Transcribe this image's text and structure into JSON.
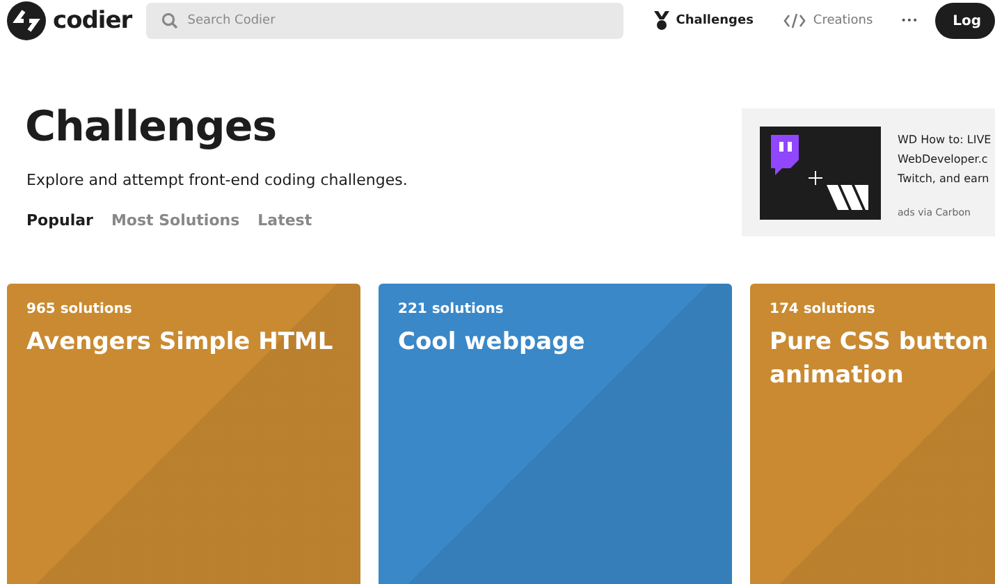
{
  "header": {
    "logo": "codier",
    "search": {
      "placeholder": "Search Codier"
    },
    "nav": [
      {
        "label": "Challenges",
        "kind": "trophy",
        "selected": true
      },
      {
        "label": "Creations",
        "kind": "code",
        "selected": false
      }
    ],
    "more": "•••",
    "login": "Log"
  },
  "hero": {
    "title": "Challenges",
    "description": "Explore and attempt front-end coding challenges.",
    "tabs": [
      {
        "label": "Popular",
        "selected": true
      },
      {
        "label": "Most Solutions",
        "selected": false
      },
      {
        "label": "Latest",
        "selected": false
      }
    ]
  },
  "ad": {
    "lines": [
      "WD How to: LIVE",
      "WebDeveloper.c",
      "Twitch, and earn"
    ],
    "via": "ads via Carbon"
  },
  "cards": [
    {
      "solutions": "965 solutions",
      "title": "Avengers Simple HTML",
      "color": "#c98a31"
    },
    {
      "solutions": "221 solutions",
      "title": "Cool webpage",
      "color": "#3a88c8"
    },
    {
      "solutions": "174 solutions",
      "title": "Pure CSS button animation",
      "color": "#c98a31"
    }
  ]
}
